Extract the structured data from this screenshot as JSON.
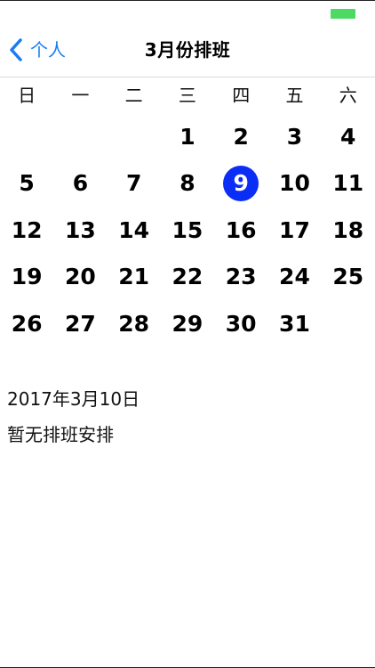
{
  "header": {
    "back_label": "个人",
    "title": "3月份排班"
  },
  "calendar": {
    "weekdays": [
      "日",
      "一",
      "二",
      "三",
      "四",
      "五",
      "六"
    ],
    "leading_blanks": 3,
    "days": [
      "1",
      "2",
      "3",
      "4",
      "5",
      "6",
      "7",
      "8",
      "9",
      "10",
      "11",
      "12",
      "13",
      "14",
      "15",
      "16",
      "17",
      "18",
      "19",
      "20",
      "21",
      "22",
      "23",
      "24",
      "25",
      "26",
      "27",
      "28",
      "29",
      "30",
      "31"
    ],
    "selected_day": "9",
    "selected_color": "#0a2ef5"
  },
  "info": {
    "date": "2017年3月10日",
    "note": "暂无排班安排"
  },
  "colors": {
    "accent": "#1a7cf5",
    "battery": "#4cd964"
  },
  "icons": {
    "back": "chevron-left-icon",
    "battery": "battery-icon"
  }
}
